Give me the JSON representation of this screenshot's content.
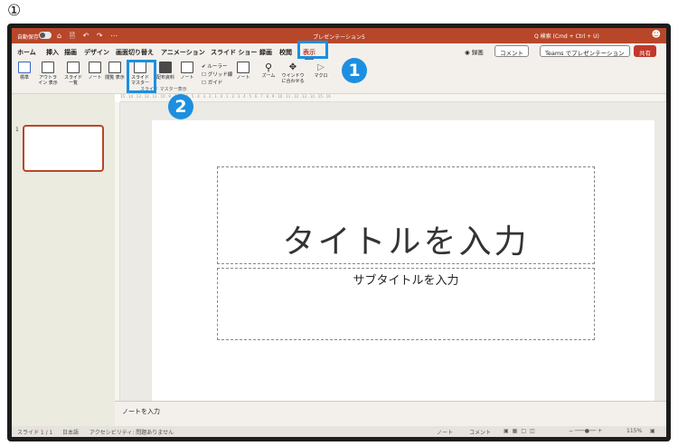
{
  "step_label": "①",
  "titlebar": {
    "autosave": "自動保存",
    "icons": "⌂ 🗎 ↶ ↷ ⋯",
    "doc_title": "プレゼンテーション5",
    "search": "Q 検索 (Cmd + Ctrl + U)"
  },
  "tabs": [
    "ホーム",
    "挿入",
    "描画",
    "デザイン",
    "画面切り替え",
    "アニメーション",
    "スライド ショー",
    "録画",
    "校閲",
    "表示"
  ],
  "active_tab": "表示",
  "tab_right": {
    "record": "◉ 録画",
    "comment": "コメント",
    "teams": "Teams でプレゼンテーション",
    "share": "共有"
  },
  "ribbon": {
    "standard": "標準",
    "outline": "アウトライン 表示",
    "sorter": "スライド 一覧",
    "notes_page": "ノート",
    "reading": "閲覧 表示",
    "slide_master": "スライド マスター",
    "handout_master": "配布資料",
    "notes_master": "ノート",
    "ruler": "ルーラー",
    "gridlines": "グリッド線",
    "guides": "ガイド",
    "notes": "ノート",
    "zoom": "ズーム",
    "fit_window": "ウインドウ に合わせる",
    "macro": "マクロ",
    "caption": "スライド マスター表示"
  },
  "badges": {
    "one": "1",
    "two": "2"
  },
  "ruler_text": "15 . 14 . 13 . 12 . 11 . 10 . 9 . 8 . 7 . 6 . 5 . 4 . 3 . 2 . 1 . 0 . 1 . 2 . 3 . 4 . 5 . 6 . 7 . 8 . 9 . 10 . 11 . 12 . 13 . 14 . 15 . 16",
  "thumb_number": "1",
  "slide": {
    "title": "タイトルを入力",
    "subtitle": "サブタイトルを入力"
  },
  "notes_placeholder": "ノートを入力",
  "status": {
    "slide_count": "スライド 1 / 1",
    "language": "日本語",
    "accessibility": "アクセシビリティ: 問題ありません",
    "notes": "ノート",
    "comments": "コメント",
    "zoom": "115%"
  },
  "colors": {
    "accent": "#b8472a",
    "callout": "#1c8fe0"
  }
}
